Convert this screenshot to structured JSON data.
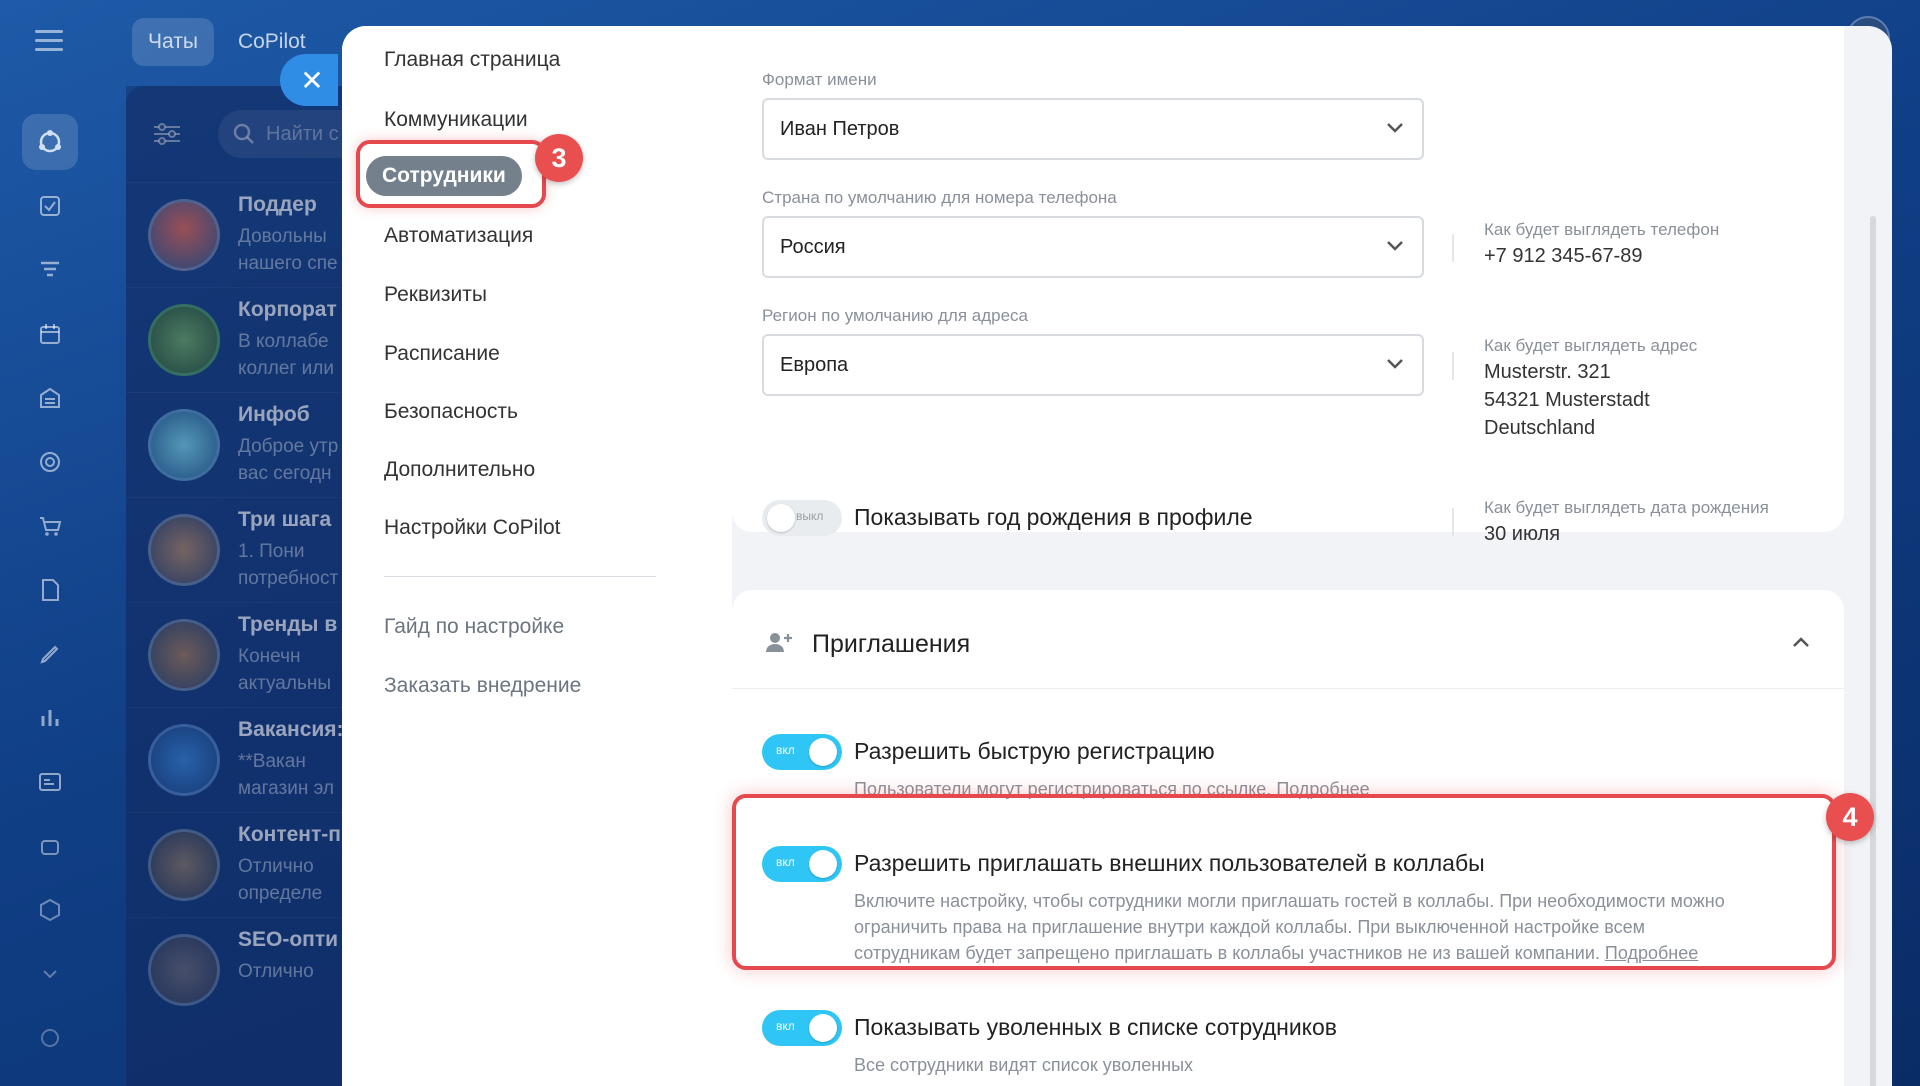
{
  "tabs": {
    "chats": "Чаты",
    "copilot": "CoPilot"
  },
  "chat_search": {
    "placeholder": "Найти с"
  },
  "chats": [
    {
      "title": "Поддер",
      "preview1": "Довольны",
      "preview2": "нашего спе"
    },
    {
      "title": "Корпорат",
      "preview1": "В коллабе",
      "preview2": "коллег или"
    },
    {
      "title": "Инфоб",
      "preview1": "Доброе утр",
      "preview2": "вас сегодн"
    },
    {
      "title": "Три шага",
      "preview1": "1. Пони",
      "preview2": "потребност"
    },
    {
      "title": "Тренды в",
      "preview1": "Конечн",
      "preview2": "актуальны"
    },
    {
      "title": "Вакансия:",
      "preview1": "**Вакан",
      "preview2": "магазин эл"
    },
    {
      "title": "Контент-п",
      "preview1": "Отлично",
      "preview2": "определе"
    },
    {
      "title": "SEO-опти",
      "preview1": "Отлично",
      "preview2": ""
    }
  ],
  "nav": {
    "items": [
      "Главная страница",
      "Коммуникации",
      "Сотрудники",
      "Автоматизация",
      "Реквизиты",
      "Расписание",
      "Безопасность",
      "Дополнительно",
      "Настройки CoPilot"
    ],
    "guide": "Гайд по настройке",
    "order": "Заказать внедрение"
  },
  "badges": {
    "b3": "3",
    "b4": "4"
  },
  "form": {
    "name_format": {
      "label": "Формат имени",
      "value": "Иван Петров"
    },
    "phone_country": {
      "label": "Страна по умолчанию для номера телефона",
      "value": "Россия",
      "preview_label": "Как будет выглядеть телефон",
      "preview_value": "+7 912 345-67-89"
    },
    "address_region": {
      "label": "Регион по умолчанию для адреса",
      "value": "Европа",
      "preview_label": "Как будет выглядеть адрес",
      "preview_lines": [
        "Musterstr. 321",
        "54321 Musterstadt",
        "Deutschland"
      ]
    },
    "birthday": {
      "toggle": "выкл",
      "label": "Показывать год рождения в профиле",
      "preview_label": "Как будет выглядеть дата рождения",
      "preview_value": "30 июля"
    }
  },
  "invitations": {
    "title": "Приглашения",
    "options": [
      {
        "toggle": "вкл",
        "title": "Разрешить быструю регистрацию",
        "desc": "Пользователи могут регистрироваться по ссылке.",
        "link": "Подробнее"
      },
      {
        "toggle": "вкл",
        "title": "Разрешить приглашать внешних пользователей в коллабы",
        "desc1": "Включите настройку, чтобы сотрудники могли приглашать гостей в коллабы. При необходимости можно",
        "desc2": "ограничить права на приглашение внутри каждой коллабы. При выключенной настройке всем",
        "desc3": "сотрудникам будет запрещено приглашать в коллабы участников не из вашей компании.",
        "link": "Подробнее"
      },
      {
        "toggle": "вкл",
        "title": "Показывать уволенных в списке сотрудников",
        "desc": "Все сотрудники видят список уволенных"
      }
    ]
  },
  "colors": {
    "accent": "#2fc6f6",
    "highlight": "#e5484d",
    "close": "#2f8de6"
  }
}
